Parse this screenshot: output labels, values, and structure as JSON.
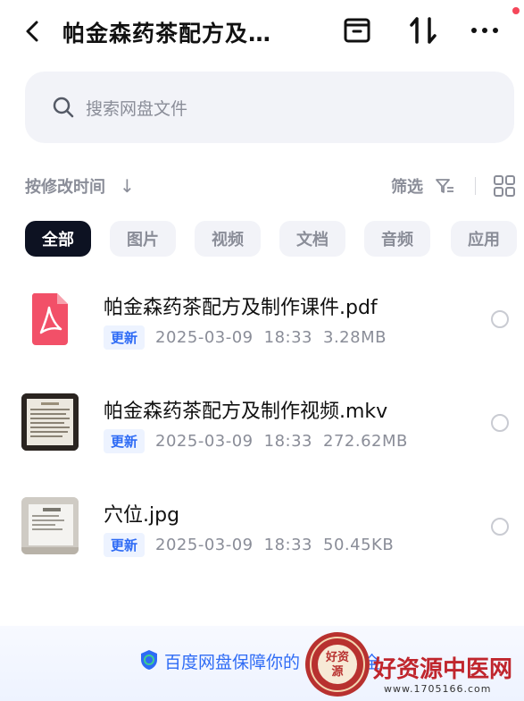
{
  "header": {
    "title": "帕金森药茶配方及…",
    "back_icon": "chevron-left-icon",
    "actions": [
      "box-icon",
      "sort-icon",
      "more-icon"
    ]
  },
  "search": {
    "placeholder": "搜索网盘文件"
  },
  "sort": {
    "label": "按修改时间",
    "arrow": "↓",
    "filter_label": "筛选"
  },
  "tabs": [
    {
      "label": "全部",
      "active": true
    },
    {
      "label": "图片",
      "active": false
    },
    {
      "label": "视频",
      "active": false
    },
    {
      "label": "文档",
      "active": false
    },
    {
      "label": "音频",
      "active": false
    },
    {
      "label": "应用",
      "active": false
    }
  ],
  "files": [
    {
      "name": "帕金森药茶配方及制作课件.pdf",
      "badge": "更新",
      "date": "2025-03-09",
      "time": "18:33",
      "size": "3.28MB",
      "icon": "pdf-icon"
    },
    {
      "name": "帕金森药茶配方及制作视频.mkv",
      "badge": "更新",
      "date": "2025-03-09",
      "time": "18:33",
      "size": "272.62MB",
      "icon": "video-thumbnail"
    },
    {
      "name": "穴位.jpg",
      "badge": "更新",
      "date": "2025-03-09",
      "time": "18:33",
      "size": "50.45KB",
      "icon": "image-thumbnail"
    }
  ],
  "footer": {
    "text": "百度网盘保障你的",
    "suffix": "全"
  },
  "watermark": {
    "seal_text": "好资源",
    "text": "好资源中医网",
    "url": "www.1705166.com"
  },
  "colors": {
    "accent": "#2e6bf5",
    "pdf_red": "#f25068",
    "chip_active": "#0d1222",
    "muted": "#8a8d98",
    "watermark_red": "#c0262d"
  }
}
